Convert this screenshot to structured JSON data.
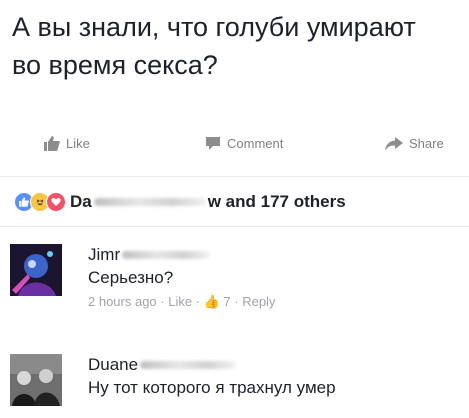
{
  "post": {
    "text": "А вы знали, что голуби умирают во время секса?"
  },
  "actions": {
    "like_label": "Like",
    "comment_label": "Comment",
    "share_label": "Share"
  },
  "reactions": {
    "name_start": "Da",
    "name_end": "w and 177 others"
  },
  "comments": [
    {
      "name": "Jimr",
      "text": "Серьезно?",
      "meta": "2 hours ago · Like · 👍 7 · Reply"
    },
    {
      "name": "Duane",
      "text": "Ну тот которого я трахнул умер"
    }
  ],
  "colors": {
    "link_blue": "#5890ff",
    "haha_yellow": "#f7c744",
    "love_red": "#f25268",
    "muted_gray": "#a0a3a8"
  }
}
